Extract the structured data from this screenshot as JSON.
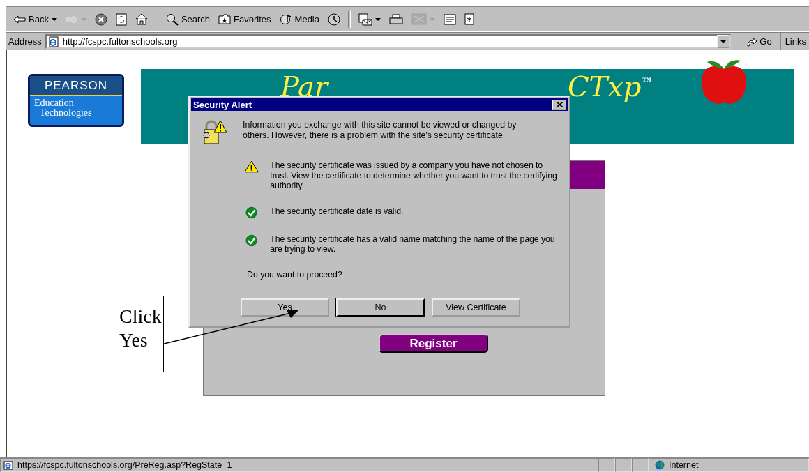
{
  "toolbar": {
    "buttons": [
      {
        "kind": "back",
        "label": "Back",
        "disabled": false,
        "dropdown": true
      },
      {
        "kind": "forward",
        "disabled": true,
        "dropdown": true
      },
      {
        "kind": "stop",
        "disabled": false,
        "dropdown": false
      },
      {
        "kind": "refresh",
        "disabled": false,
        "dropdown": false
      },
      {
        "kind": "home",
        "disabled": false,
        "dropdown": false
      },
      {
        "kind": "separator"
      },
      {
        "kind": "search",
        "label": "Search",
        "disabled": false,
        "dropdown": false
      },
      {
        "kind": "favorites",
        "label": "Favorites",
        "disabled": false,
        "dropdown": false
      },
      {
        "kind": "media",
        "label": "Media",
        "disabled": false,
        "dropdown": false
      },
      {
        "kind": "history",
        "disabled": false,
        "dropdown": false
      },
      {
        "kind": "separator"
      },
      {
        "kind": "mail",
        "disabled": false,
        "dropdown": true
      },
      {
        "kind": "print",
        "disabled": false,
        "dropdown": false
      },
      {
        "kind": "edit",
        "disabled": true,
        "dropdown": true
      },
      {
        "kind": "discuss",
        "disabled": false,
        "dropdown": false
      },
      {
        "kind": "messenger",
        "disabled": false,
        "dropdown": false
      }
    ]
  },
  "address_bar": {
    "label": "Address",
    "value": "http://fcspc.fultonschools.org",
    "go": "Go",
    "links": "Links"
  },
  "page": {
    "logo": {
      "line_1": "PEARSON",
      "line_2": "Education",
      "line_3": "Technologies"
    },
    "banner": {
      "title_start": "Par",
      "title_end": "CTxp",
      "trademark": "™"
    },
    "register_button": "Register"
  },
  "dialog": {
    "title": "Security Alert",
    "intro": "Information you exchange with this site cannot be viewed or changed by others. However, there is a problem with the site's security certificate.",
    "items": [
      {
        "kind": "warning",
        "text": "The security certificate was issued by a company you have not chosen to trust. View the certificate to determine whether you want to trust the certifying authority."
      },
      {
        "kind": "ok",
        "text": "The security certificate date is valid."
      },
      {
        "kind": "ok",
        "text": "The security certificate has a valid name matching the name of the page you are trying to view."
      }
    ],
    "question": "Do you want to proceed?",
    "buttons": [
      {
        "label": "Yes",
        "default": false
      },
      {
        "label": "No",
        "default": true
      },
      {
        "label": "View Certificate",
        "default": false
      }
    ]
  },
  "callout": {
    "text": "Click Yes"
  },
  "status_bar": {
    "url": "https://fcspc.fultonschools.org/PreReg.asp?RegState=1",
    "zone": "Internet"
  }
}
